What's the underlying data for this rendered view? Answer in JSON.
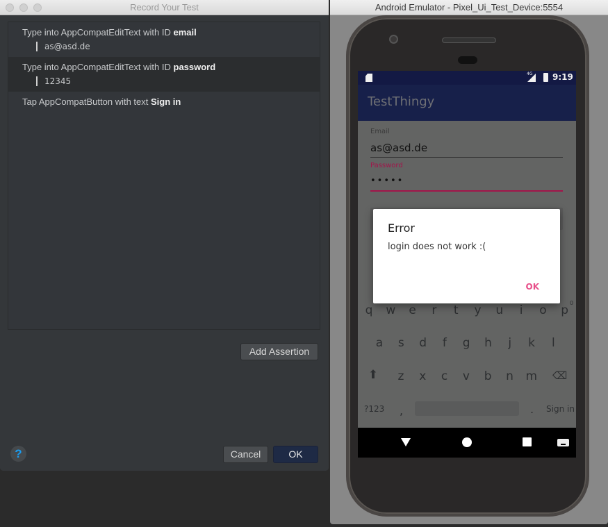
{
  "record_window": {
    "title": "Record Your Test",
    "steps": [
      {
        "prefix": "Type into AppCompatEditText with ID ",
        "target": "email",
        "value": "as@asd.de"
      },
      {
        "prefix": "Type into AppCompatEditText with ID ",
        "target": "password",
        "value": "12345"
      },
      {
        "prefix": "Tap AppCompatButton with text ",
        "target": "Sign in"
      }
    ],
    "add_assertion_label": "Add Assertion",
    "cancel_label": "Cancel",
    "ok_label": "OK",
    "help_label": "?"
  },
  "emulator_window": {
    "title": "Android Emulator - Pixel_Ui_Test_Device:5554",
    "status_bar": {
      "network": "4G",
      "time": "9:19"
    },
    "app": {
      "title": "TestThingy",
      "email_label": "Email",
      "email_value": "as@asd.de",
      "password_label": "Password",
      "password_value": "•••••",
      "accent_color": "#d81b60"
    },
    "dialog": {
      "title": "Error",
      "message": "login does not work :(",
      "ok_label": "OK"
    },
    "keyboard": {
      "row1": [
        "q",
        "w",
        "e",
        "r",
        "t",
        "y",
        "u",
        "i",
        "o",
        "p"
      ],
      "row2": [
        "a",
        "s",
        "d",
        "f",
        "g",
        "h",
        "j",
        "k",
        "l"
      ],
      "row3": [
        "z",
        "x",
        "c",
        "v",
        "b",
        "n",
        "m"
      ],
      "hint_p": "0",
      "symbols_label": "?123",
      "comma_label": ",",
      "period_label": ".",
      "action_label": "Sign in"
    }
  }
}
